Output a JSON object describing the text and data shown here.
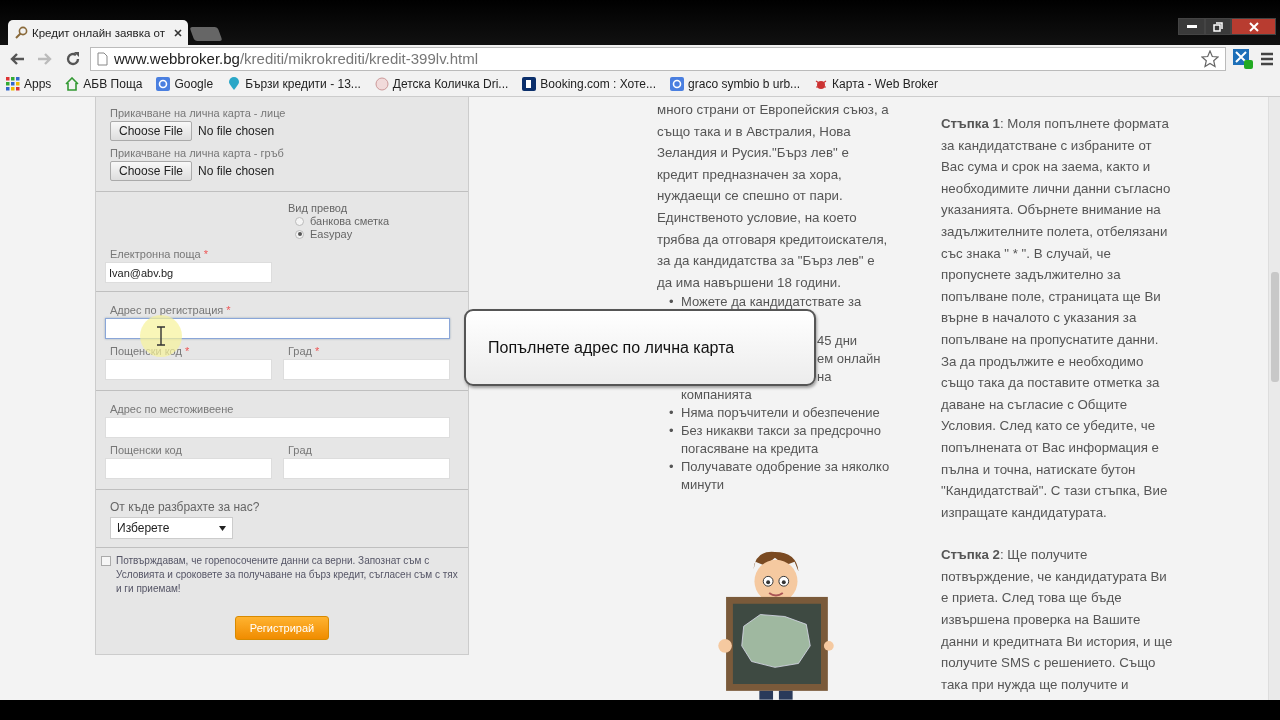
{
  "browser": {
    "tab_title": "Кредит онлайн заявка от",
    "url_host": "www.webbroker.bg",
    "url_path": "/krediti/mikrokrediti/kredit-399lv.html",
    "bookmarks": [
      {
        "label": "Apps",
        "kind": "apps"
      },
      {
        "label": "АБВ Поща",
        "kind": "home"
      },
      {
        "label": "Google",
        "kind": "google"
      },
      {
        "label": "Бързи кредити - 13...",
        "kind": "pin"
      },
      {
        "label": "Детска Количка Dri...",
        "kind": "ball"
      },
      {
        "label": "Booking.com : Хоте...",
        "kind": "booking"
      },
      {
        "label": "graco symbio b urb...",
        "kind": "google"
      },
      {
        "label": "Карта - Web Broker",
        "kind": "bug"
      }
    ]
  },
  "form": {
    "uploads": [
      {
        "label": "Прикачване на лична карта - лице",
        "button": "Choose File",
        "status": "No file chosen"
      },
      {
        "label": "Прикачване на лична карта - гръб",
        "button": "Choose File",
        "status": "No file chosen"
      }
    ],
    "transfer": {
      "label": "Вид превод",
      "options": [
        {
          "label": "банкова сметка",
          "selected": false
        },
        {
          "label": "Easypay",
          "selected": true
        }
      ]
    },
    "email": {
      "label": "Електронна поща",
      "required_mark": "*",
      "value": "Ivan@abv.bg"
    },
    "address_groups": [
      {
        "address": {
          "label": "Адрес по регистрация",
          "required_mark": "*",
          "focused": true
        },
        "postcode": {
          "label": "Пощенски код",
          "required_mark": "*"
        },
        "city": {
          "label": "Град",
          "required_mark": "*"
        }
      },
      {
        "address": {
          "label": "Адрес по местоживеене",
          "focused": false
        },
        "postcode": {
          "label": "Пощенски код"
        },
        "city": {
          "label": "Град"
        }
      }
    ],
    "source": {
      "label": "От къде разбрахте за нас?",
      "value": "Изберете"
    },
    "consent": {
      "checked": false,
      "text": "Потвърждавам, че горепосочените данни са верни. Запознат съм с Условията и сроковете за получаване на бърз кредит, съгласен съм с тях и ги приемам!"
    },
    "submit": "Регистрирай"
  },
  "info": {
    "paragraph": "много страни от Европейския съюз, а също така и в Австралия, Нова Зеландия и Русия.\"Бърз лев\" е кредит предназначен за хора, нуждаещи се спешно от пари. Единственото условие, на което трябва да отговаря кредитоискателя, за да кандидатства за \"Бърз лев\" е да има навършени 18 години.",
    "bullets": [
      {
        "kind": "partial",
        "marker": "•",
        "lines": [
          {
            "text": "Можете да кандидатствате за",
            "clipped": false
          },
          {
            "text": "45 дни",
            "clipped": true
          },
          {
            "text": "ем онлайн",
            "clipped": true
          },
          {
            "text": "на",
            "clipped": true
          },
          {
            "text": "компанията",
            "clipped": false
          }
        ]
      },
      {
        "kind": "plain",
        "marker": "•",
        "text": "Няма поръчители и обезпечение"
      },
      {
        "kind": "plain",
        "marker": "•",
        "text": "Без никакви такси за предсрочно погасяване на кредита"
      },
      {
        "kind": "plain",
        "marker": "•",
        "text": "Получавате одобрение за няколко минути"
      }
    ]
  },
  "callout": {
    "text": "Попълнете адрес по лична карта"
  },
  "steps": [
    {
      "text": "**Стъпка 1**: Моля попълнете формата за кандидатстване с избраните от Вас сума и срок на заема, както и необходимите лични данни съгласно указанията. Обърнете внимание на задължителните полета, отбелязани със знака \" * \". В случай, че пропуснете задължително за попълване поле, страницата ще Ви върне в началото с указания за попълване на пропуснатите данни. За да продължите е необходимо също така да поставите отметка за даване на съгласие с Общите Условия. След като се убедите, че попълнената от Вас информация е пълна и точна, натискате бутон \"Кандидатствай\". С тази стъпка, Вие изпращате кандидатурата."
    },
    {
      "text": "**Стъпка 2**: Ще получите потвърждение, че кандидатурата Ви е приета. След това ще бъде извършена проверка на Вашите данни и кредитната Ви история, и ще получите SMS с решението. Също така при нужда ще получите и"
    }
  ]
}
